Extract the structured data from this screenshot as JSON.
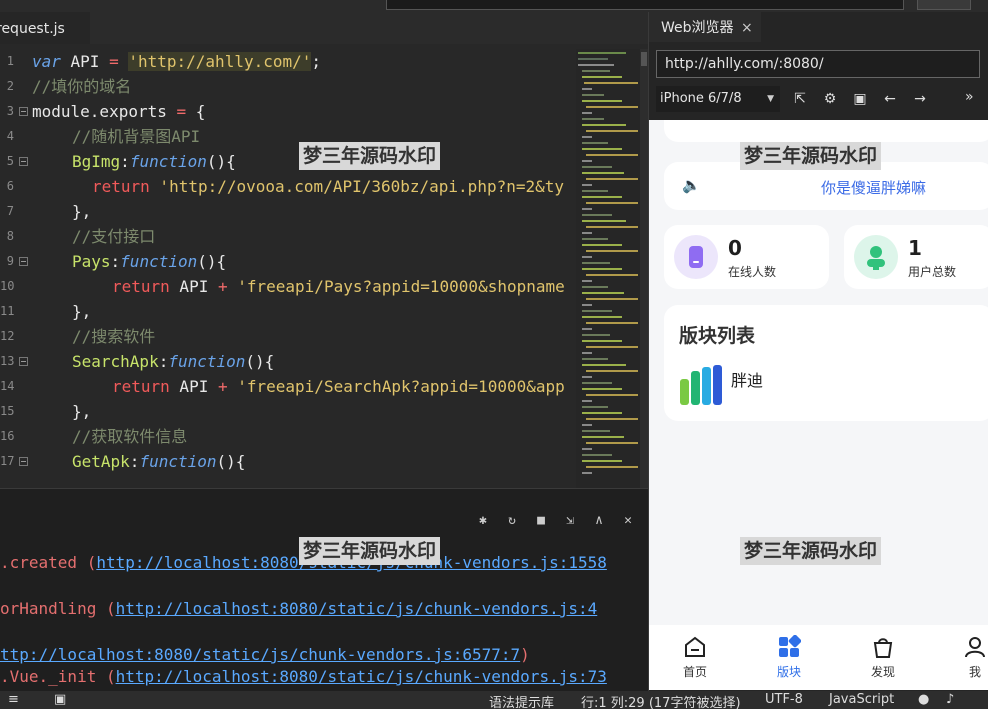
{
  "editor": {
    "tab_label": "request.js",
    "lines": [
      {
        "n": "1"
      },
      {
        "n": "2"
      },
      {
        "n": "3"
      },
      {
        "n": "4"
      },
      {
        "n": "5"
      },
      {
        "n": "6"
      },
      {
        "n": "7"
      },
      {
        "n": "8"
      },
      {
        "n": "9"
      },
      {
        "n": "10"
      },
      {
        "n": "11"
      },
      {
        "n": "12"
      },
      {
        "n": "13"
      },
      {
        "n": "14"
      },
      {
        "n": "15"
      },
      {
        "n": "16"
      },
      {
        "n": "17"
      }
    ],
    "code": {
      "l1": {
        "kw": "var",
        "name": " API ",
        "eq": "=",
        "sp": " ",
        "str": "'http://ahlly.com/'",
        "end": ";"
      },
      "l2": {
        "comment": "//填你的域名"
      },
      "l3": {
        "a": "module.exports ",
        "eq": "=",
        "b": " {"
      },
      "l4": {
        "comment": "//随机背景图API"
      },
      "l5": {
        "prop": "BgImg",
        "colon": ":",
        "fn": "function",
        "tail": "(){"
      },
      "l6": {
        "ret": "return",
        "str": " 'http://ovooa.com/API/360bz/api.php?n=2&ty"
      },
      "l7": {
        "txt": "},"
      },
      "l8": {
        "comment": "//支付接口"
      },
      "l9": {
        "prop": "Pays",
        "colon": ":",
        "fn": "function",
        "tail": "(){"
      },
      "l10": {
        "ret": "return",
        "api": " API ",
        "op": "+",
        "str": " 'freeapi/Pays?appid=10000&shopname"
      },
      "l11": {
        "txt": "},"
      },
      "l12": {
        "comment": "//搜索软件"
      },
      "l13": {
        "prop": "SearchApk",
        "colon": ":",
        "fn": "function",
        "tail": "(){"
      },
      "l14": {
        "ret": "return",
        "api": " API ",
        "op": "+",
        "str": " 'freeapi/SearchApk?appid=10000&app"
      },
      "l15": {
        "txt": "},"
      },
      "l16": {
        "comment": "//获取软件信息"
      },
      "l17": {
        "prop": "GetApk",
        "colon": ":",
        "fn": "function",
        "tail": "(){"
      }
    }
  },
  "console": {
    "lines": [
      {
        "pre": ".created (",
        "link": "http://localhost:8080/static/js/chunk-vendors.js:1558",
        "post": ""
      },
      {
        "pre": "orHandling (",
        "link": "http://localhost:8080/static/js/chunk-vendors.js:4",
        "post": ""
      },
      {
        "pre": "",
        "link": "ttp://localhost:8080/static/js/chunk-vendors.js:6577:7",
        "post": ")"
      },
      {
        "pre": ".Vue._init (",
        "link": "http://localhost:8080/static/js/chunk-vendors.js:73",
        "post": ""
      }
    ]
  },
  "browser": {
    "tab_label": "Web浏览器",
    "close": "×",
    "url": "http://ahlly.com/:8080/",
    "device": "iPhone 6/7/8",
    "more": "»"
  },
  "phone": {
    "notice": "你是傻逼胖娣嘛",
    "stats": [
      {
        "value": "0",
        "label": "在线人数",
        "color": "#ece6fb",
        "icon_color": "#8f6cf2"
      },
      {
        "value": "1",
        "label": "用户总数",
        "color": "#ddf5ea",
        "icon_color": "#31c27c"
      }
    ],
    "blocks_title": "版块列表",
    "block_item": "胖迪",
    "tabs": [
      {
        "label": "首页",
        "icon": "home-icon"
      },
      {
        "label": "版块",
        "icon": "grid-icon"
      },
      {
        "label": "发现",
        "icon": "discover-icon"
      },
      {
        "label": "我",
        "icon": "user-icon"
      }
    ],
    "accent": "#2f6fe8"
  },
  "watermark": "梦三年源码水印",
  "status": {
    "hint": "语法提示库",
    "position": "行:1  列:29 (17字符被选择)",
    "encoding": "UTF-8",
    "language": "JavaScript"
  }
}
